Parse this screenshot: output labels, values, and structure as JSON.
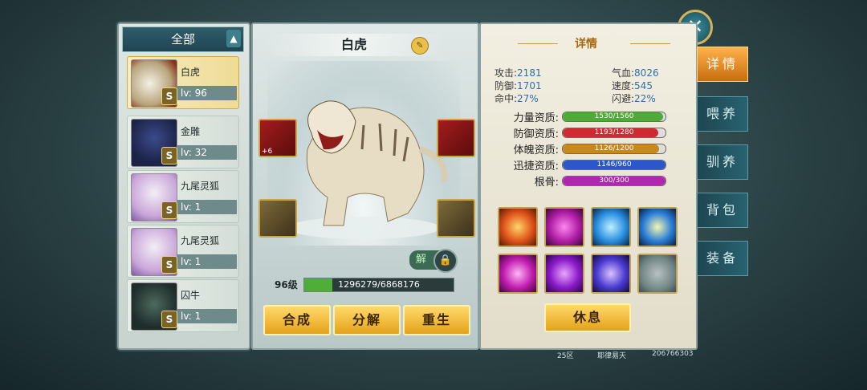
{
  "list": {
    "header": "全部",
    "collapse_icon": "▲",
    "pets": [
      {
        "name": "白虎",
        "level": "lv: 96",
        "rank": "S",
        "selected": true
      },
      {
        "name": "金雕",
        "level": "lv: 32",
        "rank": "S",
        "selected": false
      },
      {
        "name": "九尾灵狐",
        "level": "lv: 1",
        "rank": "S",
        "selected": false
      },
      {
        "name": "九尾灵狐",
        "level": "lv: 1",
        "rank": "S",
        "selected": false
      },
      {
        "name": "囚牛",
        "level": "lv: 1",
        "rank": "S",
        "selected": false
      }
    ]
  },
  "pet_view": {
    "name": "白虎",
    "edit_icon": "✎",
    "equip_badge": "+6",
    "unlock_label": "解",
    "lock_icon": "🔒",
    "level": "96级",
    "exp_text": "1296279/6868176",
    "exp_progress": 0.189
  },
  "buttons": {
    "compose": "合成",
    "decompose": "分解",
    "rebirth": "重生",
    "rest": "休息"
  },
  "details": {
    "title": "详情",
    "stats": [
      {
        "label": "攻击:",
        "value": "2181"
      },
      {
        "label": "气血:",
        "value": "8026"
      },
      {
        "label": "防御:",
        "value": "1701"
      },
      {
        "label": "速度:",
        "value": "545"
      },
      {
        "label": "命中:",
        "value": "27%"
      },
      {
        "label": "闪避:",
        "value": "22%"
      }
    ],
    "aptitudes": [
      {
        "label": "力量资质:",
        "text": "1530/1560",
        "ratio": 0.98,
        "color": "#4faa3a"
      },
      {
        "label": "防御资质:",
        "text": "1193/1280",
        "ratio": 0.93,
        "color": "#cf2a32"
      },
      {
        "label": "体魄资质:",
        "text": "1126/1200",
        "ratio": 0.94,
        "color": "#c9881a"
      },
      {
        "label": "迅捷资质:",
        "text": "1146/960",
        "ratio": 1.0,
        "color": "#2a57c9"
      },
      {
        "label": "根骨:",
        "text": "300/300",
        "ratio": 1.0,
        "color": "#b126b0"
      }
    ]
  },
  "tabs": [
    "详情",
    "喂养",
    "驯养",
    "背包",
    "装备"
  ],
  "close_icon": "✕",
  "footer": {
    "server": "25区",
    "player": "耶律易天",
    "id": "206766303"
  },
  "colors": {
    "accent_gold": "#e4a21a",
    "panel_border": "#8aa0a0"
  }
}
